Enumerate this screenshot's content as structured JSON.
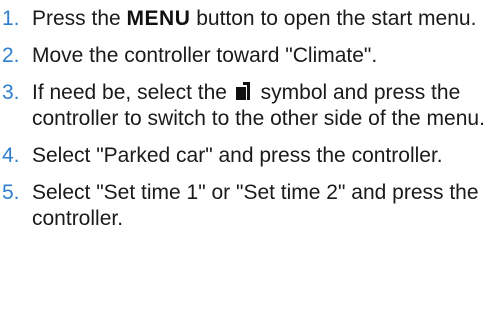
{
  "colors": {
    "step_number": "#2f7fd0",
    "text": "#1a1a1a"
  },
  "steps": [
    {
      "number": "1.",
      "text_before": "Press the ",
      "key_label": "MENU",
      "text_after": " button to open the start menu."
    },
    {
      "number": "2.",
      "text": "Move the controller toward \"Climate\"."
    },
    {
      "number": "3.",
      "text_before": "If need be, select the ",
      "icon": "switch-side-icon",
      "text_after": " symbol and press the controller to switch to the other side of the menu."
    },
    {
      "number": "4.",
      "text": "Select \"Parked car\" and press the controller."
    },
    {
      "number": "5.",
      "text": "Select \"Set time 1\" or \"Set time 2\" and press the controller."
    }
  ]
}
